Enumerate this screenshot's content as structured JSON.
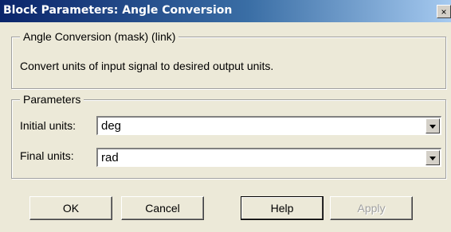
{
  "window": {
    "title": "Block Parameters: Angle Conversion",
    "close_glyph": "×"
  },
  "description": {
    "group_title": "Angle Conversion (mask) (link)",
    "text": "Convert units of input signal to desired output units."
  },
  "parameters": {
    "group_title": "Parameters",
    "initial_units": {
      "label": "Initial units:",
      "value": "deg"
    },
    "final_units": {
      "label": "Final units:",
      "value": "rad"
    }
  },
  "buttons": {
    "ok": "OK",
    "cancel": "Cancel",
    "help": "Help",
    "apply": "Apply",
    "apply_enabled": false
  }
}
